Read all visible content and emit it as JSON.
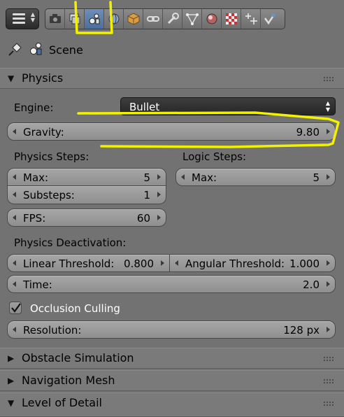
{
  "context": {
    "title": "Scene"
  },
  "panels": {
    "physics": {
      "title": "Physics",
      "engine": {
        "label": "Engine:",
        "value": "Bullet"
      },
      "gravity": {
        "label": "Gravity:",
        "value": "9.80"
      },
      "physics_steps": {
        "heading": "Physics Steps:",
        "max": {
          "label": "Max:",
          "value": "5"
        },
        "substeps": {
          "label": "Substeps:",
          "value": "1"
        },
        "fps": {
          "label": "FPS:",
          "value": "60"
        }
      },
      "logic_steps": {
        "heading": "Logic Steps:",
        "max": {
          "label": "Max:",
          "value": "5"
        }
      },
      "deactivation": {
        "heading": "Physics Deactivation:",
        "linear": {
          "label": "Linear Threshold:",
          "value": "0.800"
        },
        "angular": {
          "label": "Angular Threshold:",
          "value": "1.000"
        },
        "time": {
          "label": "Time:",
          "value": "2.0"
        }
      },
      "occlusion": {
        "label": "Occlusion Culling",
        "checked": true
      },
      "resolution": {
        "label": "Resolution:",
        "value": "128 px"
      }
    },
    "obstacle": {
      "title": "Obstacle Simulation"
    },
    "navmesh": {
      "title": "Navigation Mesh"
    },
    "lod": {
      "title": "Level of Detail"
    }
  },
  "toolbar": {
    "tabs": [
      "render-icon",
      "render-layers-icon",
      "scene-icon",
      "world-icon",
      "object-icon",
      "constraints-icon",
      "modifiers-icon",
      "data-icon",
      "material-icon",
      "texture-icon",
      "particles-icon",
      "physics-icon"
    ],
    "active_tab": "scene-icon"
  },
  "colors": {
    "annotation": "#f2f200",
    "active_tab": "#5a7bab",
    "background": "#727272"
  }
}
